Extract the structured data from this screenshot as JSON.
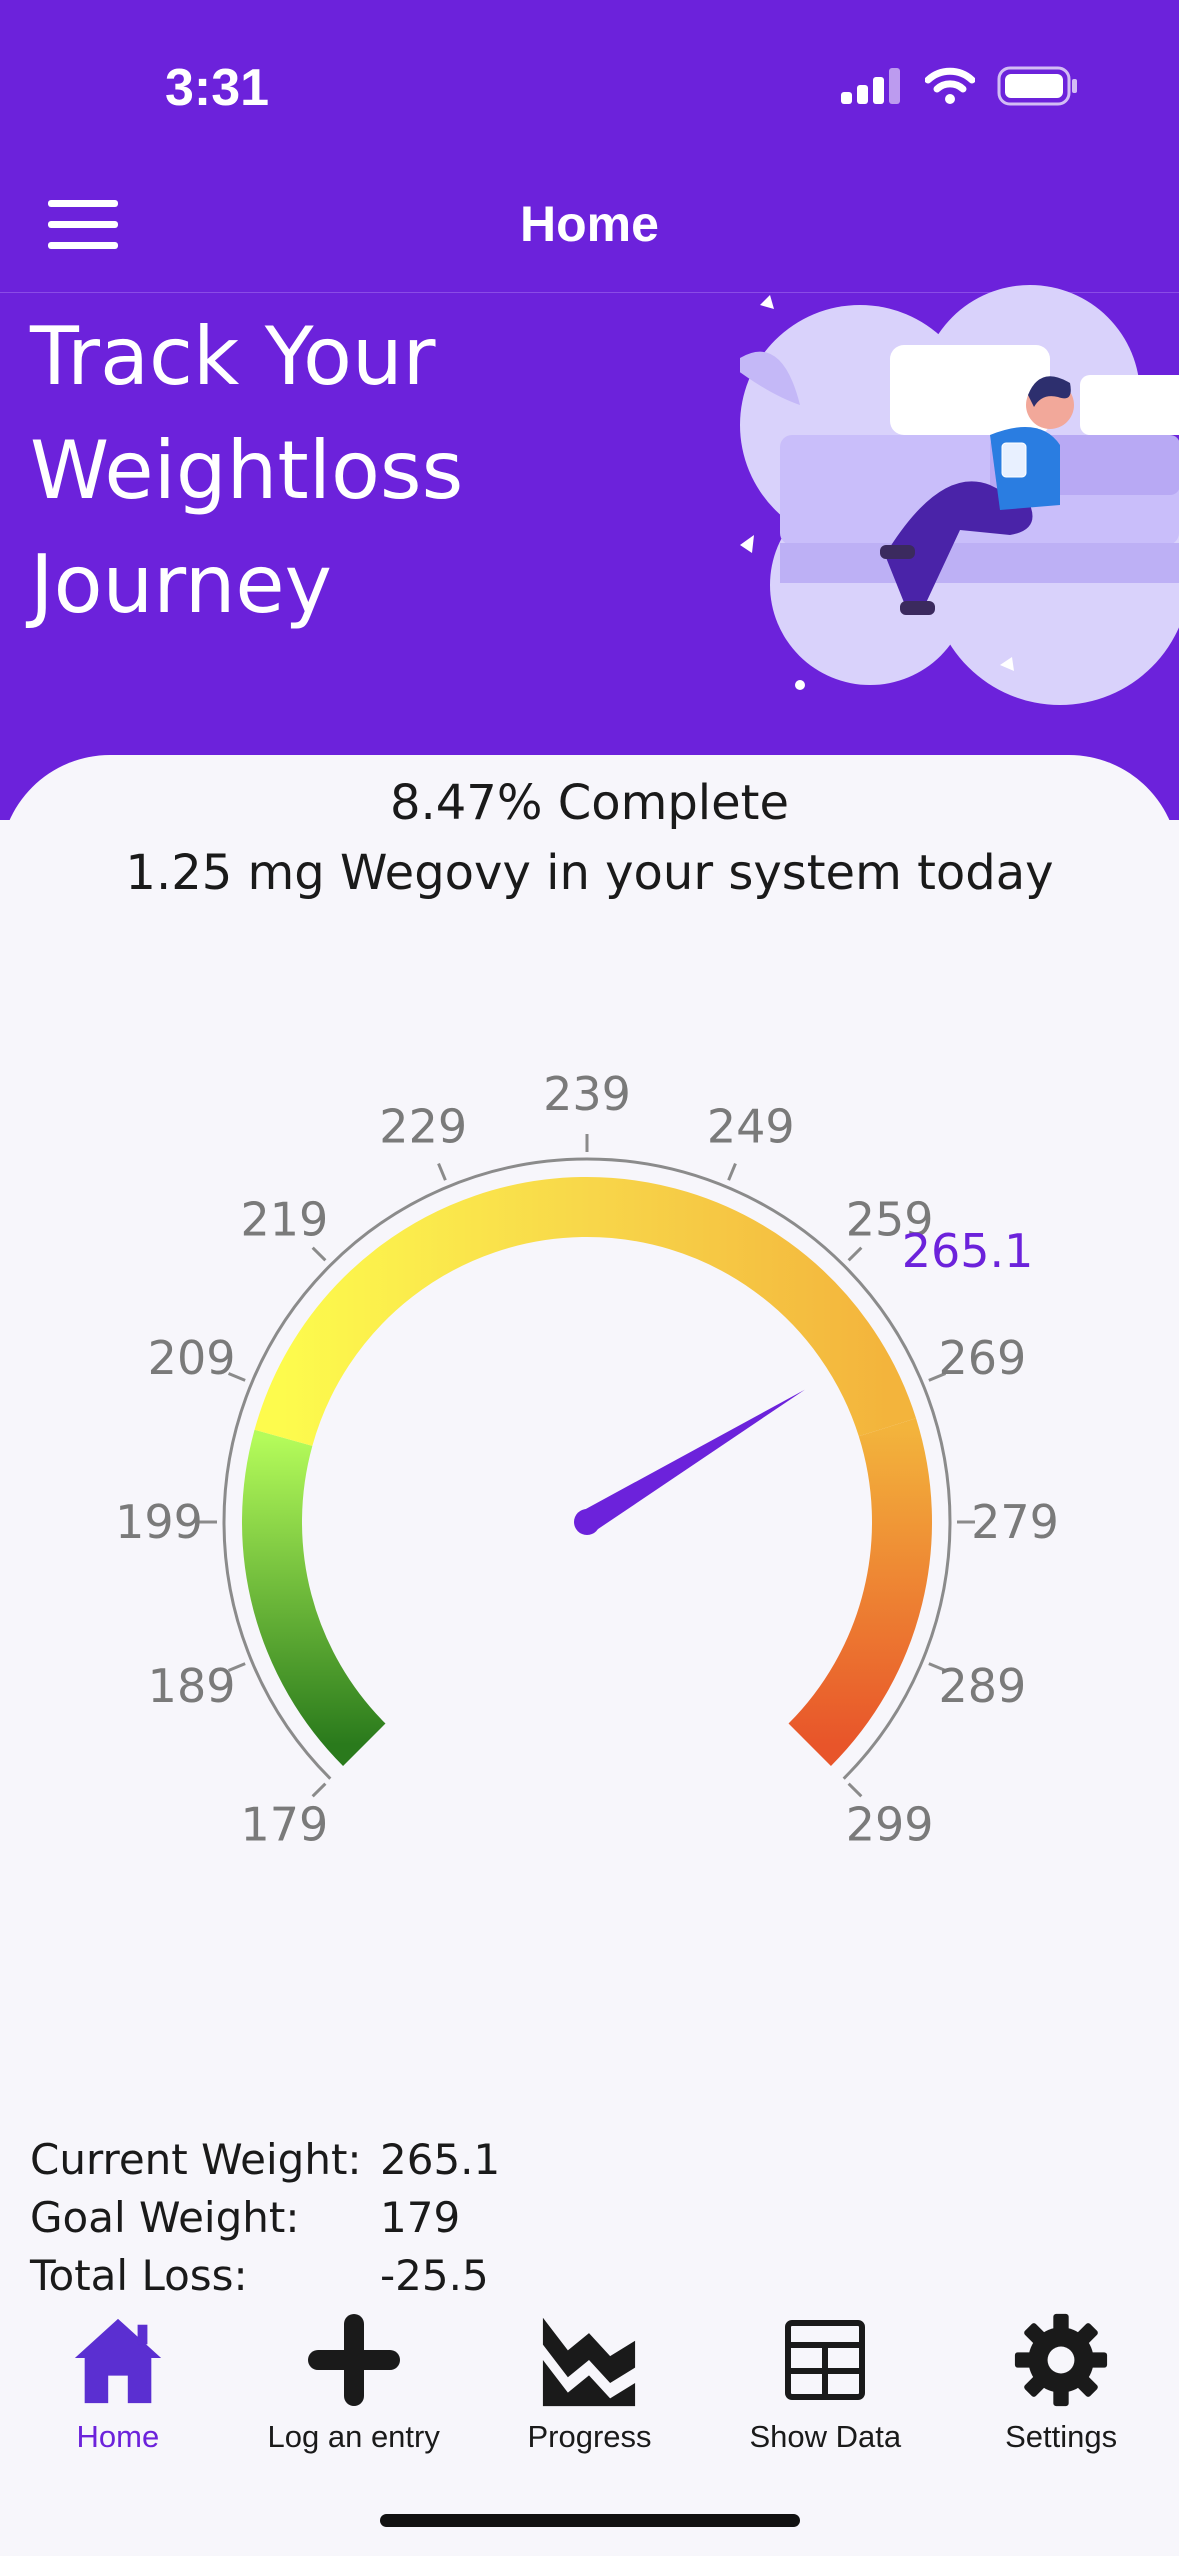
{
  "status": {
    "time": "3:31"
  },
  "header": {
    "title": "Home"
  },
  "hero": {
    "tagline": "Track Your Weightloss Journey"
  },
  "summary": {
    "percent_complete": "8.47% Complete",
    "dose": "1.25 mg Wegovy in your system today"
  },
  "gauge": {
    "current_label": "265.1",
    "ticks": [
      "179",
      "189",
      "199",
      "209",
      "219",
      "229",
      "239",
      "249",
      "259",
      "269",
      "279",
      "289",
      "299"
    ],
    "current_value": 265.1,
    "min": 179,
    "max": 299
  },
  "stats": {
    "current_label": "Current Weight:",
    "current_value": "265.1",
    "goal_label": "Goal Weight:",
    "goal_value": "179",
    "loss_label": "Total Loss:",
    "loss_value": "-25.5"
  },
  "tabs": [
    {
      "label": "Home",
      "icon": "home-icon"
    },
    {
      "label": "Log an entry",
      "icon": "plus-icon"
    },
    {
      "label": "Progress",
      "icon": "chart-icon"
    },
    {
      "label": "Show Data",
      "icon": "table-icon"
    },
    {
      "label": "Settings",
      "icon": "gear-icon"
    }
  ],
  "colors": {
    "accent": "#6c22db",
    "needle": "#6c22db"
  }
}
